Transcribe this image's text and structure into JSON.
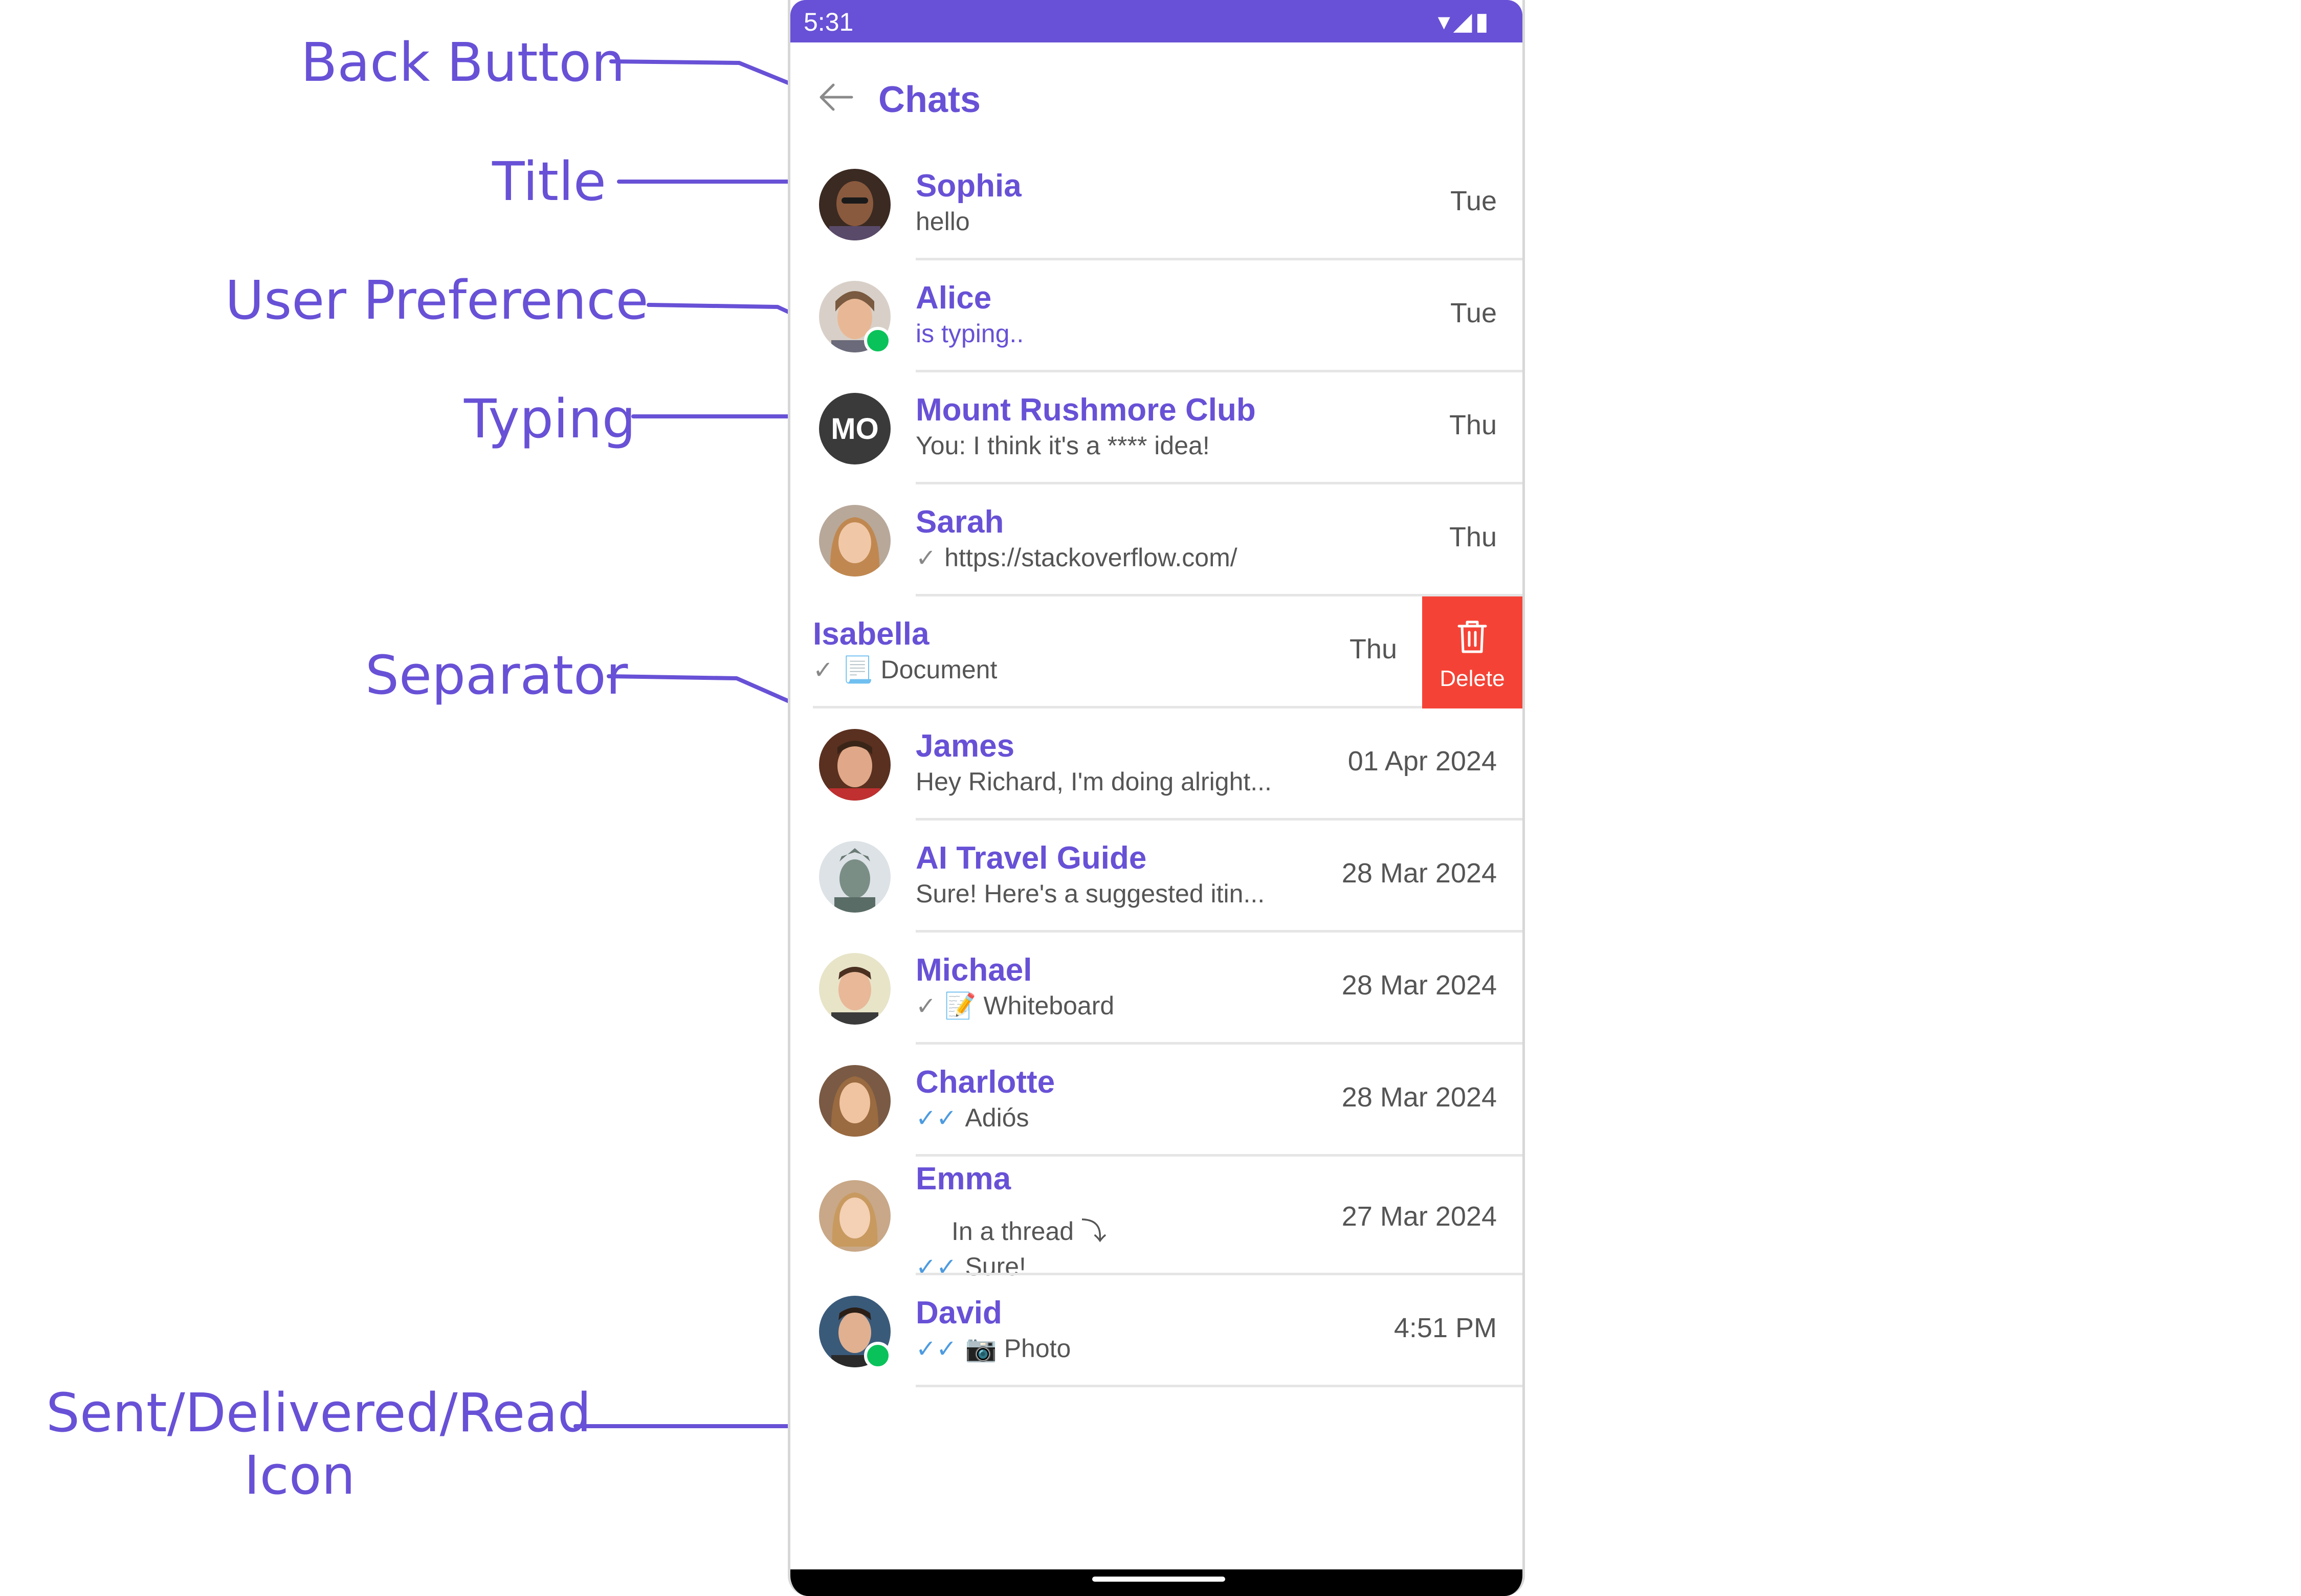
{
  "annotations": {
    "back_button": "Back Button",
    "title": "Title",
    "user_preference": "User Preference",
    "typing": "Typing",
    "separator": "Separator",
    "receipt_line1": "Sent/Delivered/Read",
    "receipt_line2": "Icon"
  },
  "status_bar": {
    "time": "5:31",
    "system_icons": "▾◢▮"
  },
  "header": {
    "title": "Chats",
    "back_icon": "arrow-left-icon"
  },
  "conversations": [
    {
      "name": "Sophia",
      "subtitle": "hello",
      "time": "Tue"
    },
    {
      "name": "Alice",
      "subtitle": "is typing..",
      "time": "Tue",
      "online": true
    },
    {
      "name": "Mount Rushmore Club",
      "initials": "MO",
      "subtitle": "You: I think it's a **** idea!",
      "time": "Thu"
    },
    {
      "name": "Sarah",
      "receipt": "✓",
      "subtitle": "https://stackoverflow.com/",
      "time": "Thu"
    },
    {
      "name": "Isabella",
      "receipt": "✓",
      "attachment_icon": "📃",
      "subtitle": "Document",
      "time": "Thu",
      "action": "Delete"
    },
    {
      "name": "James",
      "subtitle": "Hey Richard, I'm doing alright...",
      "time": "01 Apr 2024"
    },
    {
      "name": "AI Travel Guide",
      "subtitle": "Sure! Here's a suggested itin...",
      "time": "28 Mar 2024"
    },
    {
      "name": "Michael",
      "receipt": "✓",
      "attachment_icon": "📝",
      "subtitle": "Whiteboard",
      "time": "28 Mar 2024"
    },
    {
      "name": "Charlotte",
      "receipt": "✓✓",
      "subtitle": "Adiós",
      "time": "28 Mar 2024"
    },
    {
      "name": "Emma",
      "thread_label": "In a thread",
      "thread_icon": "⤵",
      "receipt": "✓✓",
      "subtitle": "Sure!",
      "time": "27 Mar 2024"
    },
    {
      "name": "David",
      "receipt": "✓✓",
      "attachment_icon": "📷",
      "subtitle": "Photo",
      "time": "4:51 PM",
      "online": true
    }
  ],
  "colors": {
    "accent": "#6851d6",
    "online": "#0ac25a",
    "delete": "#f44336",
    "read_receipt": "#4d9be0"
  }
}
